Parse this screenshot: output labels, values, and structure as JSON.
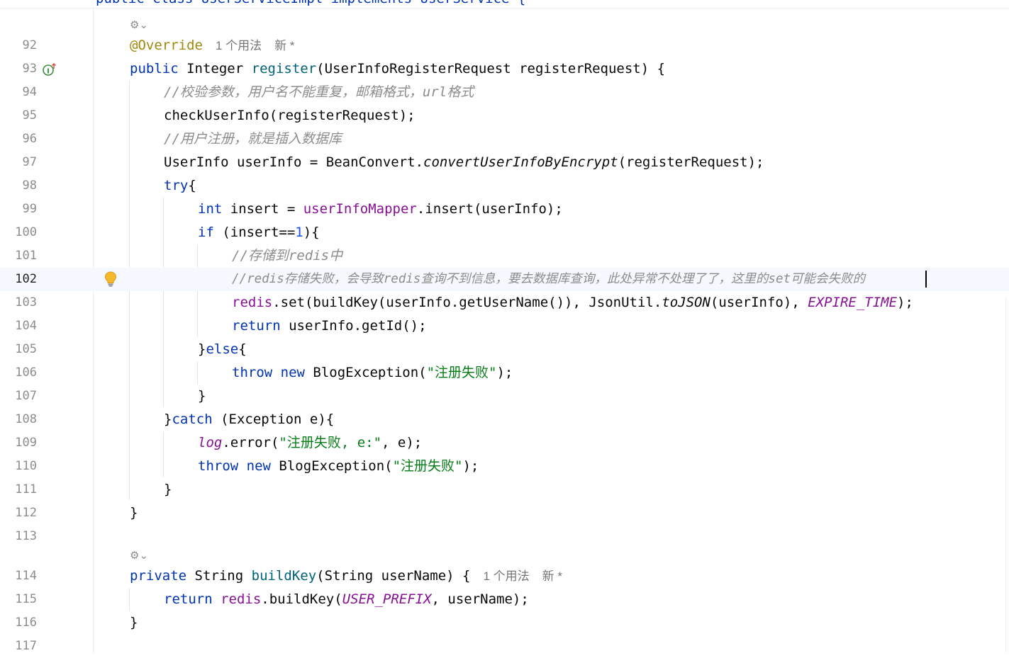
{
  "top_line": "public class UserServiceImpl implements UserService {",
  "hints": {
    "override": {
      "usages": "1 个用法",
      "new": "新 *"
    },
    "buildkey": {
      "usages": "1 个用法",
      "new": "新 *"
    }
  },
  "lines": {
    "n92": "92",
    "n93": "93",
    "n94": "94",
    "n95": "95",
    "n96": "96",
    "n97": "97",
    "n98": "98",
    "n99": "99",
    "n100": "100",
    "n101": "101",
    "n102": "102",
    "n103": "103",
    "n104": "104",
    "n105": "105",
    "n106": "106",
    "n107": "107",
    "n108": "108",
    "n109": "109",
    "n110": "110",
    "n111": "111",
    "n112": "112",
    "n113": "113",
    "n114": "114",
    "n115": "115",
    "n116": "116",
    "n117": "117"
  },
  "code": {
    "l92_ann": "@Override",
    "l93_kw": "public",
    "l93_type": "Integer",
    "l93_fn": "register",
    "l93_rest": "(UserInfoRegisterRequest registerRequest) {",
    "l94_cmt": "//校验参数，用户名不能重复，邮箱格式，url格式",
    "l95": "checkUserInfo(registerRequest);",
    "l96_cmt": "//用户注册，就是插入数据库",
    "l97_a": "UserInfo userInfo = BeanConvert.",
    "l97_it": "convertUserInfoByEncrypt",
    "l97_b": "(registerRequest);",
    "l98_kw": "try",
    "l98_rest": "{",
    "l99_kw": "int",
    "l99_a": " insert = ",
    "l99_fld": "userInfoMapper",
    "l99_b": ".insert(userInfo);",
    "l100_kw": "if",
    "l100_a": " (insert==",
    "l100_num": "1",
    "l100_b": "){",
    "l101_cmt": "//存储到redis中",
    "l102_cmt": "//redis存储失败，会导致redis查询不到信息，要去数据库查询，此处异常不处理了了，这里的set可能会失败的",
    "l103_fld": "redis",
    "l103_a": ".set(buildKey(userInfo.getUserName()), JsonUtil.",
    "l103_it": "toJSON",
    "l103_b": "(userInfo), ",
    "l103_const": "EXPIRE_TIME",
    "l103_c": ");",
    "l104_kw": "return",
    "l104_rest": " userInfo.getId();",
    "l105_a": "}",
    "l105_kw": "else",
    "l105_b": "{",
    "l106_kw1": "throw",
    "l106_kw2": "new",
    "l106_a": " BlogException(",
    "l106_str": "\"注册失败\"",
    "l106_b": ");",
    "l107": "}",
    "l108_a": "}",
    "l108_kw": "catch",
    "l108_b": " (Exception e){",
    "l109_it": "log",
    "l109_a": ".error(",
    "l109_str": "\"注册失败, e:\"",
    "l109_b": ", e);",
    "l110_kw1": "throw",
    "l110_kw2": "new",
    "l110_a": " BlogException(",
    "l110_str": "\"注册失败\"",
    "l110_b": ");",
    "l111": "}",
    "l112": "}",
    "l114_kw": "private",
    "l114_type": "String",
    "l114_fn": "buildKey",
    "l114_rest": "(String userName) {",
    "l115_kw": "return",
    "l115_fld": "redis",
    "l115_a": ".buildKey(",
    "l115_const": "USER_PREFIX",
    "l115_b": ", userName);",
    "l116": "}"
  },
  "icons": {
    "ai_assist": "ai-sparkle-icon",
    "implements": "implements-interface-icon",
    "bulb": "lightbulb-intention-icon"
  }
}
